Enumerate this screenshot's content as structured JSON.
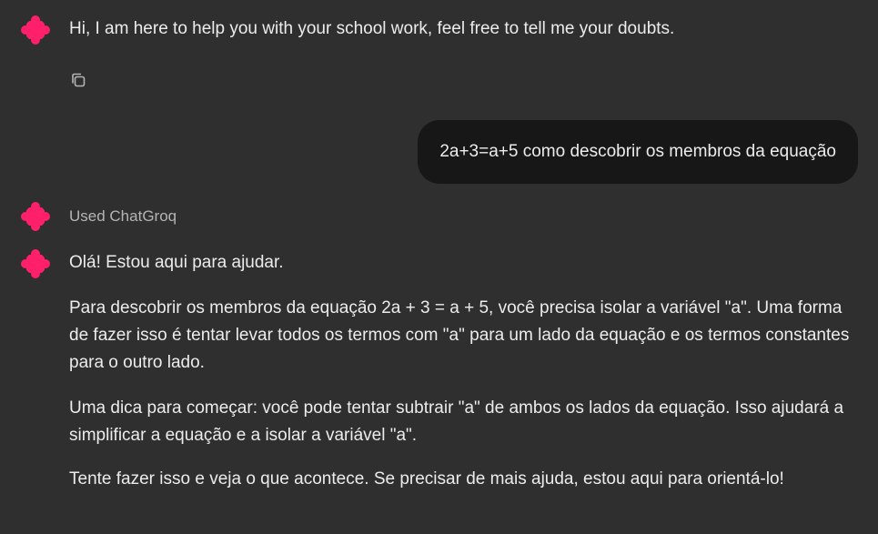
{
  "colors": {
    "background": "#2f2f2f",
    "bubble": "#171717",
    "text": "#ececec",
    "muted": "#b4b4b4",
    "brand": "#ff1f6b"
  },
  "messages": {
    "greeting": "Hi, I am here to help you with your school work, feel free to tell me your doubts.",
    "user_question": "2a+3=a+5 como descobrir os membros da equação",
    "tool_status": "Used ChatGroq",
    "reply": {
      "p1": "Olá! Estou aqui para ajudar.",
      "p2": "Para descobrir os membros da equação 2a + 3 = a + 5, você precisa isolar a variável \"a\". Uma forma de fazer isso é tentar levar todos os termos com \"a\" para um lado da equação e os termos constantes para o outro lado.",
      "p3": "Uma dica para começar: você pode tentar subtrair \"a\" de ambos os lados da equação. Isso ajudará a simplificar a equação e a isolar a variável \"a\".",
      "p4": "Tente fazer isso e veja o que acontece. Se precisar de mais ajuda, estou aqui para orientá-lo!"
    }
  },
  "icons": {
    "assistant_avatar": "assistant-logo-icon",
    "copy": "copy-icon"
  }
}
